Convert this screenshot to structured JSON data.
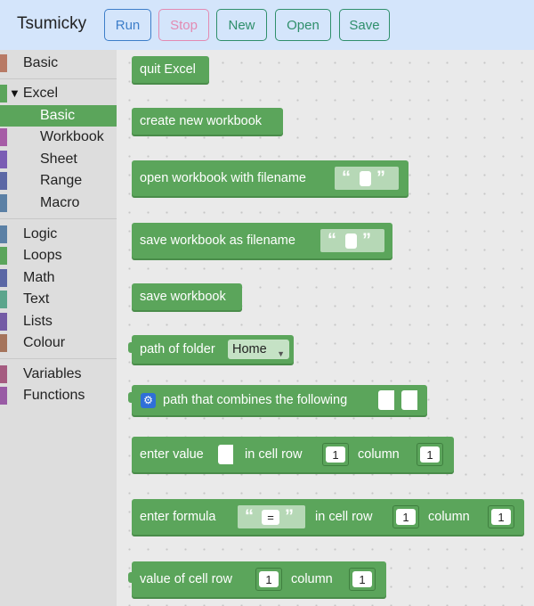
{
  "app": {
    "title": "Tsumicky"
  },
  "toolbar": {
    "run": "Run",
    "stop": "Stop",
    "new": "New",
    "open": "Open",
    "save": "Save"
  },
  "sidebar": {
    "basic": "Basic",
    "excel": "Excel",
    "excel_sub": [
      "Basic",
      "Workbook",
      "Sheet",
      "Range",
      "Macro"
    ],
    "logic": "Logic",
    "loops": "Loops",
    "math": "Math",
    "text": "Text",
    "lists": "Lists",
    "colour": "Colour",
    "variables": "Variables",
    "functions": "Functions",
    "arrow": "▼"
  },
  "colors": {
    "block_green": "#5ba55b",
    "header_bg": "#d4e5fb"
  },
  "blocks": {
    "quit_excel": "quit Excel",
    "create_workbook": "create new workbook",
    "open_workbook": "open workbook with filename",
    "save_workbook_as": "save workbook as filename",
    "save_workbook": "save workbook",
    "path_of_folder": "path of folder",
    "path_of_folder_value": "Home",
    "path_combine": "path that combines the following",
    "enter_value": "enter value",
    "in_cell_row": "in cell row",
    "column": "column",
    "enter_formula": "enter formula",
    "formula_value": "=",
    "value_of_cell_row": "value of cell row",
    "num_one": "1",
    "open_quote": "“",
    "close_quote": "”"
  }
}
